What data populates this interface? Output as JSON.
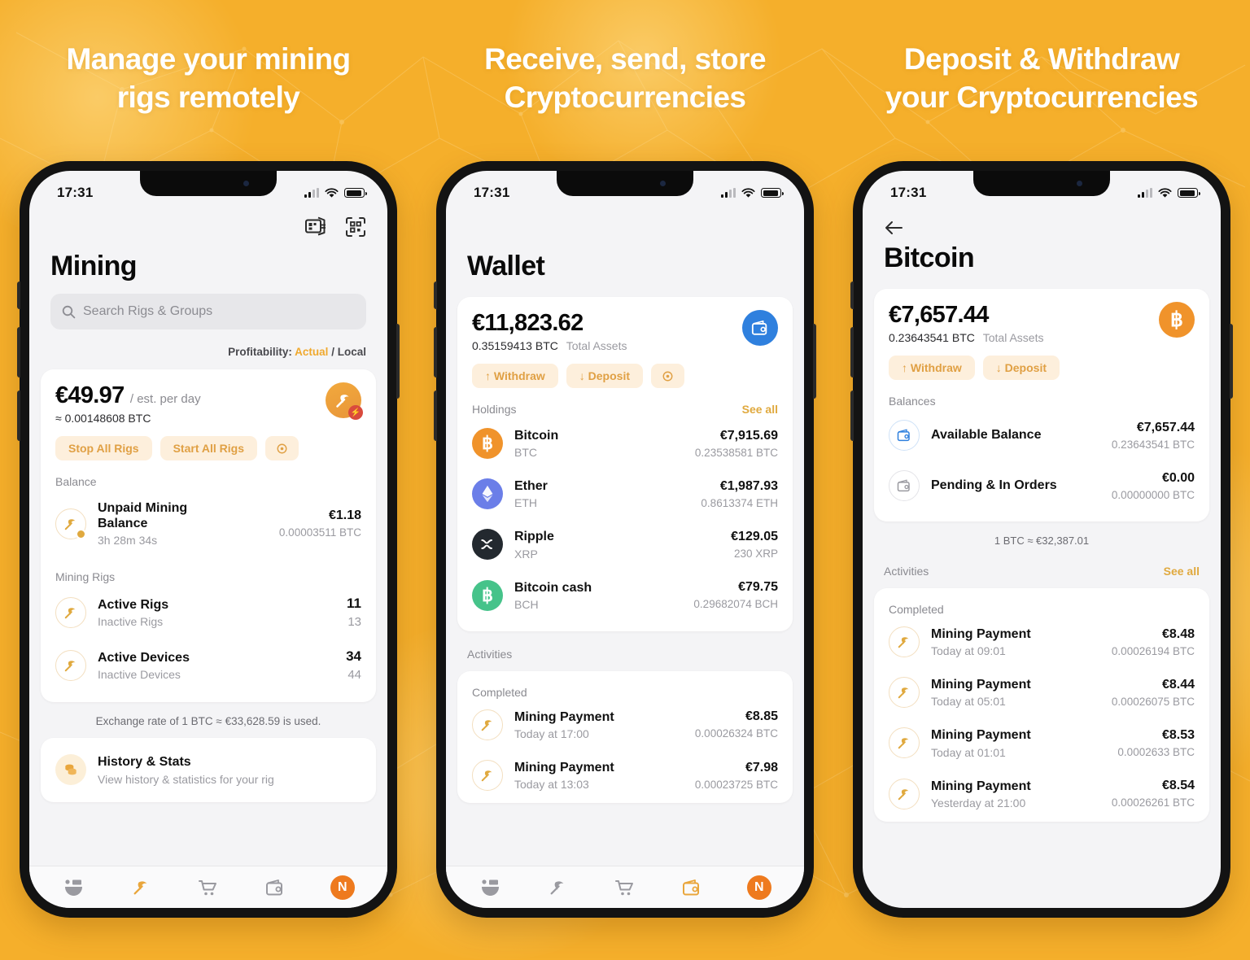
{
  "background": {
    "color": "#F5AF2B",
    "accent": "#E0A93E"
  },
  "panels": [
    {
      "headline": "Manage your mining\nrigs remotely",
      "headline_lines": [
        "Manage your mining",
        "rigs remotely"
      ],
      "status": {
        "time": "17:31",
        "signal_icon": "signal-bars-icon",
        "wifi_icon": "wifi-icon",
        "battery_icon": "battery-icon"
      },
      "header": {
        "title": "Mining",
        "icons": [
          "exchange-rate-icon",
          "qr-scan-icon"
        ]
      },
      "search": {
        "placeholder": "Search Rigs & Groups",
        "icon": "search-icon"
      },
      "profitability": {
        "label": "Profitability:",
        "actual": "Actual",
        "separator": "/",
        "local": "Local"
      },
      "summary": {
        "amount": "€49.97",
        "amount_suffix": "/ est. per day",
        "btc": "≈ 0.00148608 BTC",
        "avatar_icon": "pickaxe-icon",
        "badge_icon": "bolt-icon",
        "buttons": [
          "Stop All Rigs",
          "Start All Rigs",
          "gear-icon"
        ]
      },
      "balance_section": {
        "label": "Balance",
        "items": [
          {
            "icon": "pickaxe-clock-icon",
            "title": "Unpaid Mining Balance",
            "subtitle": "3h 28m 34s",
            "value": "€1.18",
            "value2": "0.00003511 BTC"
          }
        ]
      },
      "rigs_section": {
        "label": "Mining Rigs",
        "items": [
          {
            "icon": "pickaxe-icon",
            "title": "Active Rigs",
            "subtitle": "Inactive Rigs",
            "value": "11",
            "value2": "13"
          },
          {
            "icon": "pickaxe-icon",
            "title": "Active Devices",
            "subtitle": "Inactive Devices",
            "value": "34",
            "value2": "44"
          }
        ]
      },
      "exchange_note": "Exchange rate of 1 BTC ≈ €33,628.59 is used.",
      "history_card": {
        "icon": "coins-icon",
        "title": "History & Stats",
        "subtitle": "View history & statistics for your rig"
      },
      "tabbar": [
        "mining-pool-icon",
        "pickaxe-icon",
        "marketplace-cart-icon",
        "wallet-icon",
        "N"
      ]
    },
    {
      "headline_lines": [
        "Receive, send, store",
        "Cryptocurrencies"
      ],
      "status": {
        "time": "17:31",
        "signal_icon": "signal-bars-icon",
        "wifi_icon": "wifi-icon",
        "battery_icon": "battery-icon"
      },
      "header": {
        "title": "Wallet"
      },
      "summary": {
        "amount": "€11,823.62",
        "btc": "0.35159413 BTC",
        "btc_label": "Total Assets",
        "avatar_icon": "wallet-icon",
        "buttons": [
          "↑ Withdraw",
          "↓ Deposit",
          "gear-icon"
        ]
      },
      "holdings_section": {
        "label": "Holdings",
        "see_all": "See all",
        "items": [
          {
            "icon": "bitcoin-icon",
            "name": "Bitcoin",
            "symbol": "BTC",
            "fiat": "€7,915.69",
            "crypto": "0.23538581 BTC"
          },
          {
            "icon": "ethereum-icon",
            "name": "Ether",
            "symbol": "ETH",
            "fiat": "€1,987.93",
            "crypto": "0.8613374 ETH"
          },
          {
            "icon": "ripple-icon",
            "name": "Ripple",
            "symbol": "XRP",
            "fiat": "€129.05",
            "crypto": "230 XRP"
          },
          {
            "icon": "bitcoin-cash-icon",
            "name": "Bitcoin cash",
            "symbol": "BCH",
            "fiat": "€79.75",
            "crypto": "0.29682074 BCH"
          }
        ]
      },
      "activities_section": {
        "label": "Activities",
        "status_label": "Completed",
        "items": [
          {
            "icon": "pickaxe-icon",
            "title": "Mining Payment",
            "subtitle": "Today at 17:00",
            "value": "€8.85",
            "value2": "0.00026324 BTC"
          },
          {
            "icon": "pickaxe-icon",
            "title": "Mining Payment",
            "subtitle": "Today at 13:03",
            "value": "€7.98",
            "value2": "0.00023725 BTC"
          }
        ]
      },
      "tabbar": [
        "mining-pool-icon",
        "pickaxe-icon",
        "marketplace-cart-icon",
        "wallet-icon",
        "N"
      ]
    },
    {
      "headline_lines": [
        "Deposit & Withdraw",
        "your Cryptocurrencies"
      ],
      "status": {
        "time": "17:31",
        "signal_icon": "signal-bars-icon",
        "wifi_icon": "wifi-icon",
        "battery_icon": "battery-icon"
      },
      "header": {
        "title": "Bitcoin",
        "back_icon": "back-arrow-icon"
      },
      "summary": {
        "amount": "€7,657.44",
        "btc": "0.23643541 BTC",
        "btc_label": "Total Assets",
        "avatar_icon": "bitcoin-icon",
        "buttons": [
          "↑ Withdraw",
          "↓ Deposit"
        ]
      },
      "balances_section": {
        "label": "Balances",
        "items": [
          {
            "icon": "wallet-blue-icon",
            "title": "Available Balance",
            "value": "€7,657.44",
            "value2": "0.23643541 BTC"
          },
          {
            "icon": "wallet-gray-icon",
            "title": "Pending & In Orders",
            "value": "€0.00",
            "value2": "0.00000000 BTC"
          }
        ]
      },
      "rate_note": "1 BTC ≈ €32,387.01",
      "activities_section": {
        "label": "Activities",
        "see_all": "See all",
        "status_label": "Completed",
        "items": [
          {
            "icon": "pickaxe-icon",
            "title": "Mining Payment",
            "subtitle": "Today at 09:01",
            "value": "€8.48",
            "value2": "0.00026194 BTC"
          },
          {
            "icon": "pickaxe-icon",
            "title": "Mining Payment",
            "subtitle": "Today at 05:01",
            "value": "€8.44",
            "value2": "0.00026075 BTC"
          },
          {
            "icon": "pickaxe-icon",
            "title": "Mining Payment",
            "subtitle": "Today at 01:01",
            "value": "€8.53",
            "value2": "0.0002633 BTC"
          },
          {
            "icon": "pickaxe-icon",
            "title": "Mining Payment",
            "subtitle": "Yesterday at 21:00",
            "value": "€8.54",
            "value2": "0.00026261 BTC"
          }
        ]
      }
    }
  ]
}
